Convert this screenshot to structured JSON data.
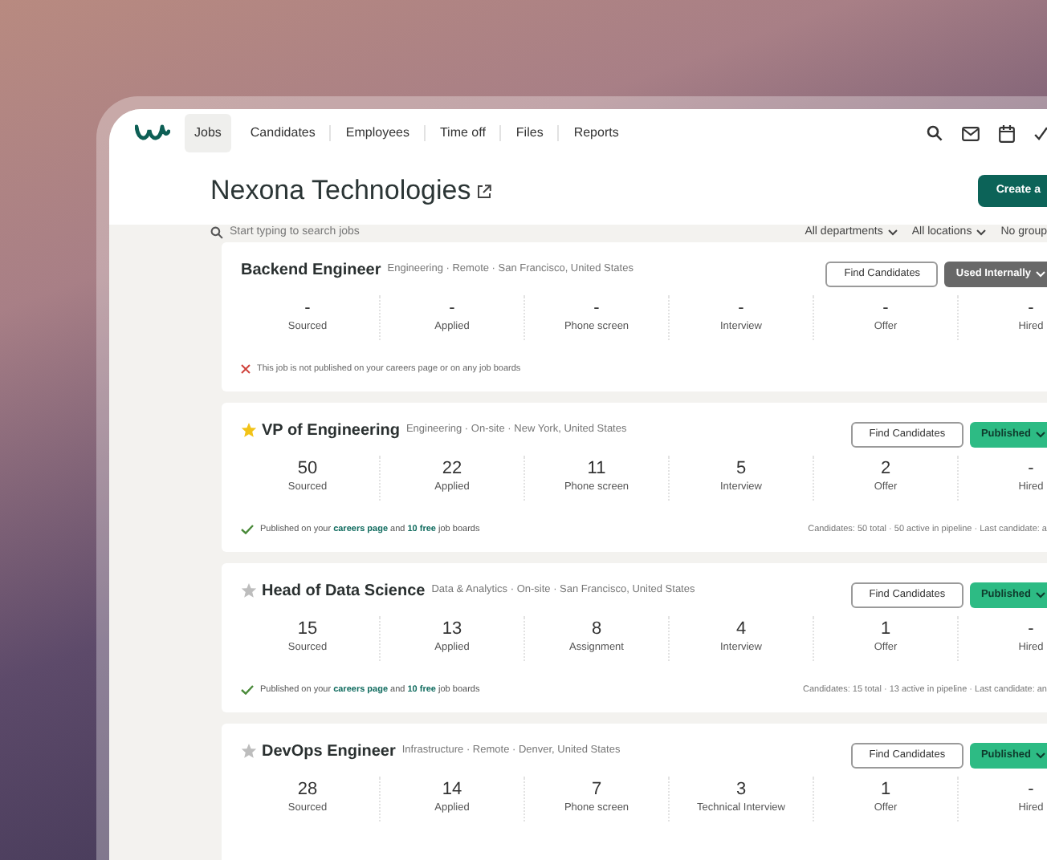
{
  "nav": {
    "tabs": [
      {
        "label": "Jobs",
        "selected": true
      },
      {
        "label": "Candidates",
        "selected": false
      },
      {
        "label": "Employees",
        "selected": false
      },
      {
        "label": "Time off",
        "selected": false
      },
      {
        "label": "Files",
        "selected": false
      },
      {
        "label": "Reports",
        "selected": false
      }
    ]
  },
  "company": {
    "title": "Nexona Technologies",
    "create_button": "Create a"
  },
  "search": {
    "placeholder": "Start typing to search jobs"
  },
  "filters": [
    {
      "label": "All departments",
      "dropdown": true
    },
    {
      "label": "All locations",
      "dropdown": true
    },
    {
      "label": "No group",
      "dropdown": false
    }
  ],
  "jobs": [
    {
      "title": "Backend Engineer",
      "meta": "Engineering · Remote · San Francisco, United States",
      "find_button": "Find Candidates",
      "status": {
        "kind": "internal",
        "label": "Used Internally"
      },
      "stages": [
        {
          "count": "-",
          "label": "Sourced"
        },
        {
          "count": "-",
          "label": "Applied"
        },
        {
          "count": "-",
          "label": "Phone screen"
        },
        {
          "count": "-",
          "label": "Interview"
        },
        {
          "count": "-",
          "label": "Offer"
        },
        {
          "count": "-",
          "label": "Hired"
        }
      ],
      "note": {
        "kind": "not_published",
        "text": "This job is not published on your careers page or on any job boards"
      }
    },
    {
      "title": "VP of Engineering",
      "starred": true,
      "meta": "Engineering · On-site · New York, United States",
      "find_button": "Find Candidates",
      "status": {
        "kind": "published",
        "label": "Published"
      },
      "stages": [
        {
          "count": "50",
          "label": "Sourced"
        },
        {
          "count": "22",
          "label": "Applied"
        },
        {
          "count": "11",
          "label": "Phone screen"
        },
        {
          "count": "5",
          "label": "Interview"
        },
        {
          "count": "2",
          "label": "Offer"
        },
        {
          "count": "-",
          "label": "Hired"
        }
      ],
      "note": {
        "kind": "published",
        "before": "Published on your",
        "link_1": "careers page",
        "middle": "and",
        "link_2": "10 free",
        "after": "job boards"
      },
      "summary": "Candidates: 50 total · 50 active in pipeline · Last candidate: a"
    },
    {
      "title": "Head of Data Science",
      "starred": false,
      "meta": "Data & Analytics · On-site · San Francisco, United States",
      "find_button": "Find Candidates",
      "status": {
        "kind": "published",
        "label": "Published"
      },
      "stages": [
        {
          "count": "15",
          "label": "Sourced"
        },
        {
          "count": "13",
          "label": "Applied"
        },
        {
          "count": "8",
          "label": "Assignment"
        },
        {
          "count": "4",
          "label": "Interview"
        },
        {
          "count": "1",
          "label": "Offer"
        },
        {
          "count": "-",
          "label": "Hired"
        }
      ],
      "note": {
        "kind": "published",
        "before": "Published on your",
        "link_1": "careers page",
        "middle": "and",
        "link_2": "10 free",
        "after": "job boards"
      },
      "summary": "Candidates: 15 total · 13 active in pipeline · Last candidate: an"
    },
    {
      "title": "DevOps Engineer",
      "starred": false,
      "meta": "Infrastructure · Remote · Denver, United States",
      "find_button": "Find Candidates",
      "status": {
        "kind": "published",
        "label": "Published"
      },
      "stages": [
        {
          "count": "28",
          "label": "Sourced"
        },
        {
          "count": "14",
          "label": "Applied"
        },
        {
          "count": "7",
          "label": "Phone screen"
        },
        {
          "count": "3",
          "label": "Technical Interview"
        },
        {
          "count": "1",
          "label": "Offer"
        },
        {
          "count": "-",
          "label": "Hired"
        }
      ]
    }
  ]
}
